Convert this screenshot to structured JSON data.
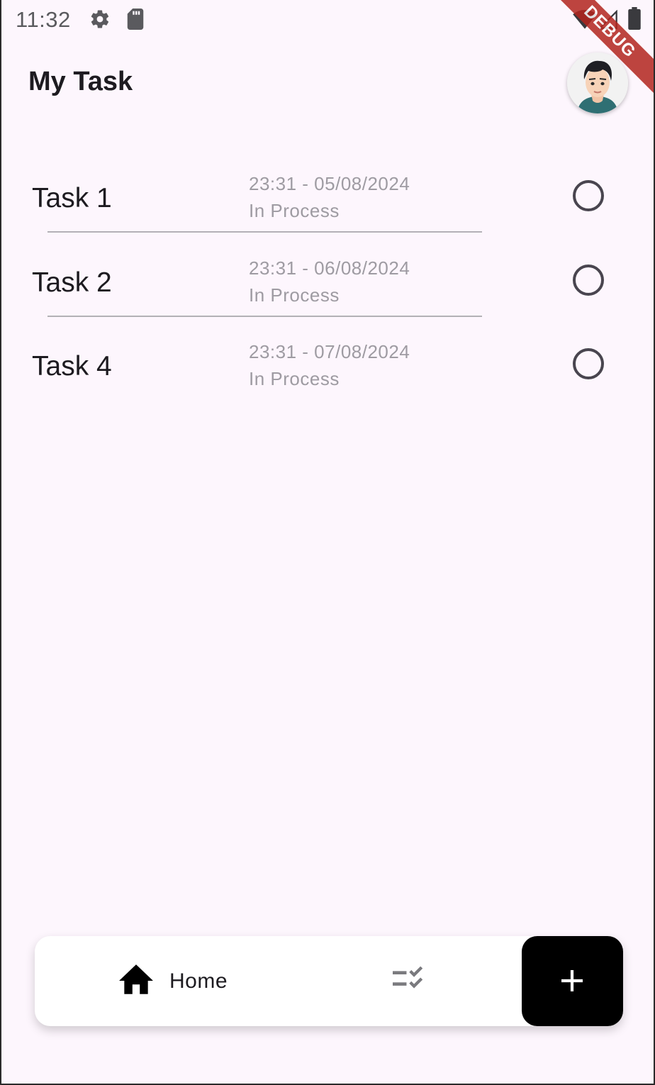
{
  "status_bar": {
    "time": "11:32",
    "icons": [
      "gear-icon",
      "sd-card-icon",
      "wifi-icon",
      "signal-icon",
      "battery-icon"
    ]
  },
  "debug_banner": "DEBUG",
  "header": {
    "title": "My Task",
    "avatar_icon": "user-avatar"
  },
  "tasks": [
    {
      "title": "Task 1",
      "datetime": "23:31 - 05/08/2024",
      "status": "In Process"
    },
    {
      "title": "Task 2",
      "datetime": "23:31 - 06/08/2024",
      "status": "In Process"
    },
    {
      "title": "Task 4",
      "datetime": "23:31 - 07/08/2024",
      "status": "In Process"
    }
  ],
  "bottom_nav": {
    "home_label": "Home",
    "home_icon": "home-icon",
    "tasks_icon": "checklist-icon",
    "add_icon": "plus-icon"
  },
  "colors": {
    "background": "#fdf6fd",
    "muted_text": "#9e9ba2",
    "add_button": "#000000",
    "debug_banner": "#b3261e"
  }
}
